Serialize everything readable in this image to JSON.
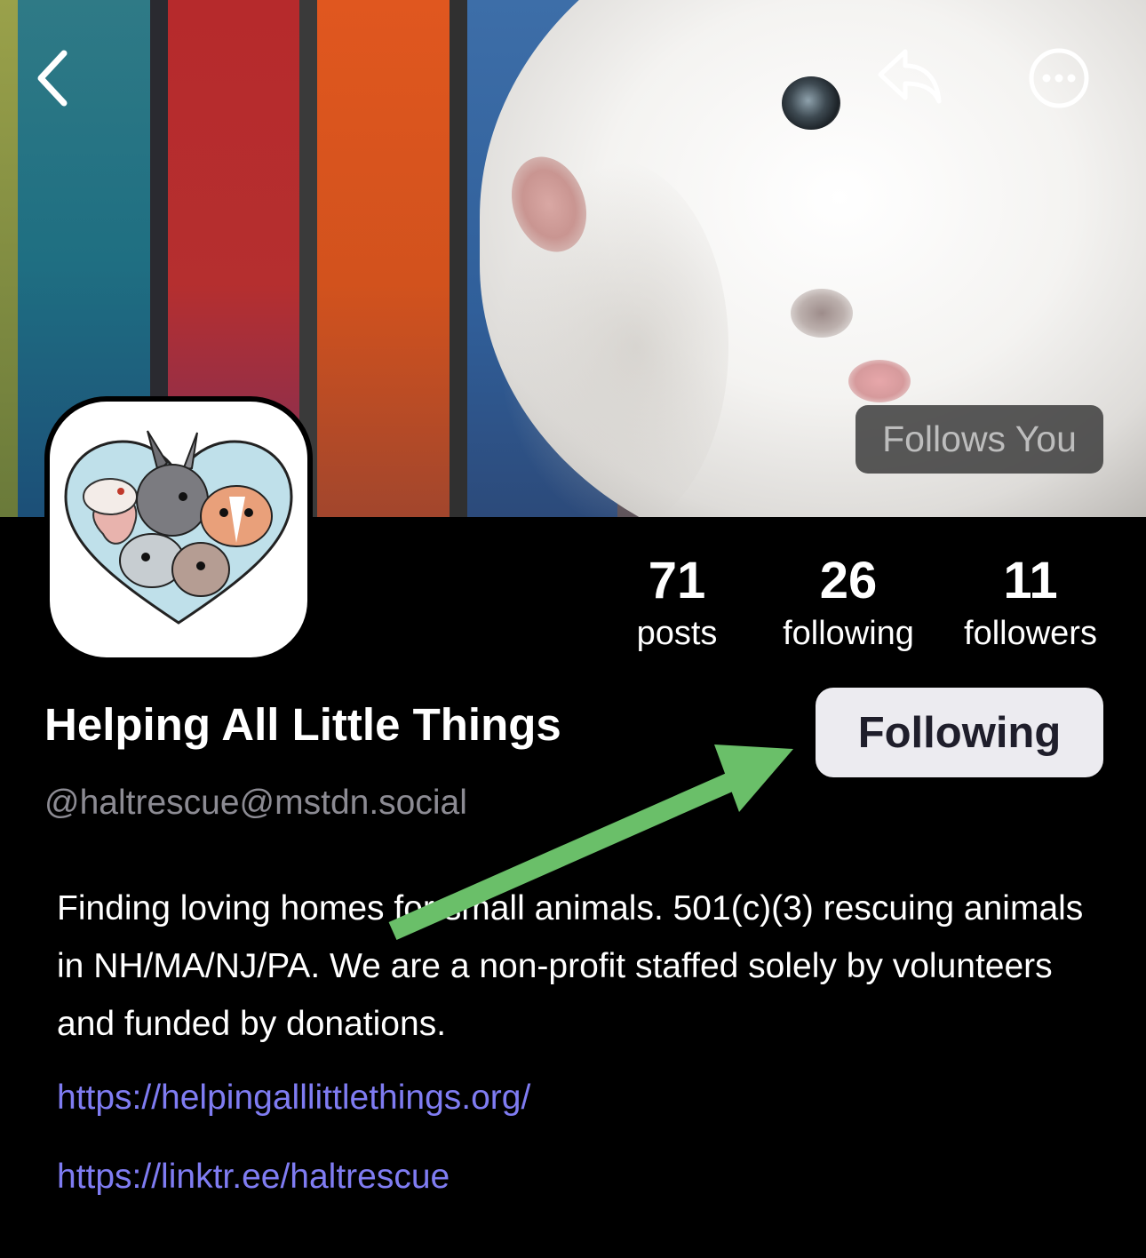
{
  "header": {
    "back_icon": "chevron-left-icon",
    "reply_icon": "reply-arrow-icon",
    "more_icon": "ellipsis-circle-icon",
    "follows_you_badge": "Follows You"
  },
  "profile": {
    "avatar_icon": "rescue-animals-heart-logo",
    "display_name": "Helping All Little Things",
    "handle": "@haltrescue@mstdn.social",
    "follow_button_label": "Following",
    "bio": "Finding loving homes for small animals. 501(c)(3) rescuing animals in NH/MA/NJ/PA. We are a non-profit staffed solely by volunteers and funded by donations.",
    "links": [
      "https://helpingalllittlethings.org/",
      "https://linktr.ee/haltrescue"
    ]
  },
  "stats": {
    "posts": {
      "count": "71",
      "label": "posts"
    },
    "following": {
      "count": "26",
      "label": "following"
    },
    "followers": {
      "count": "11",
      "label": "followers"
    }
  },
  "annotation": {
    "arrow_color": "#6abf69",
    "arrow_icon": "green-arrow-pointer"
  },
  "colors": {
    "background": "#000000",
    "link": "#7f7cf2",
    "handle": "#8c8b93",
    "button_bg": "#ecebf0",
    "button_text": "#1f1e2b"
  }
}
